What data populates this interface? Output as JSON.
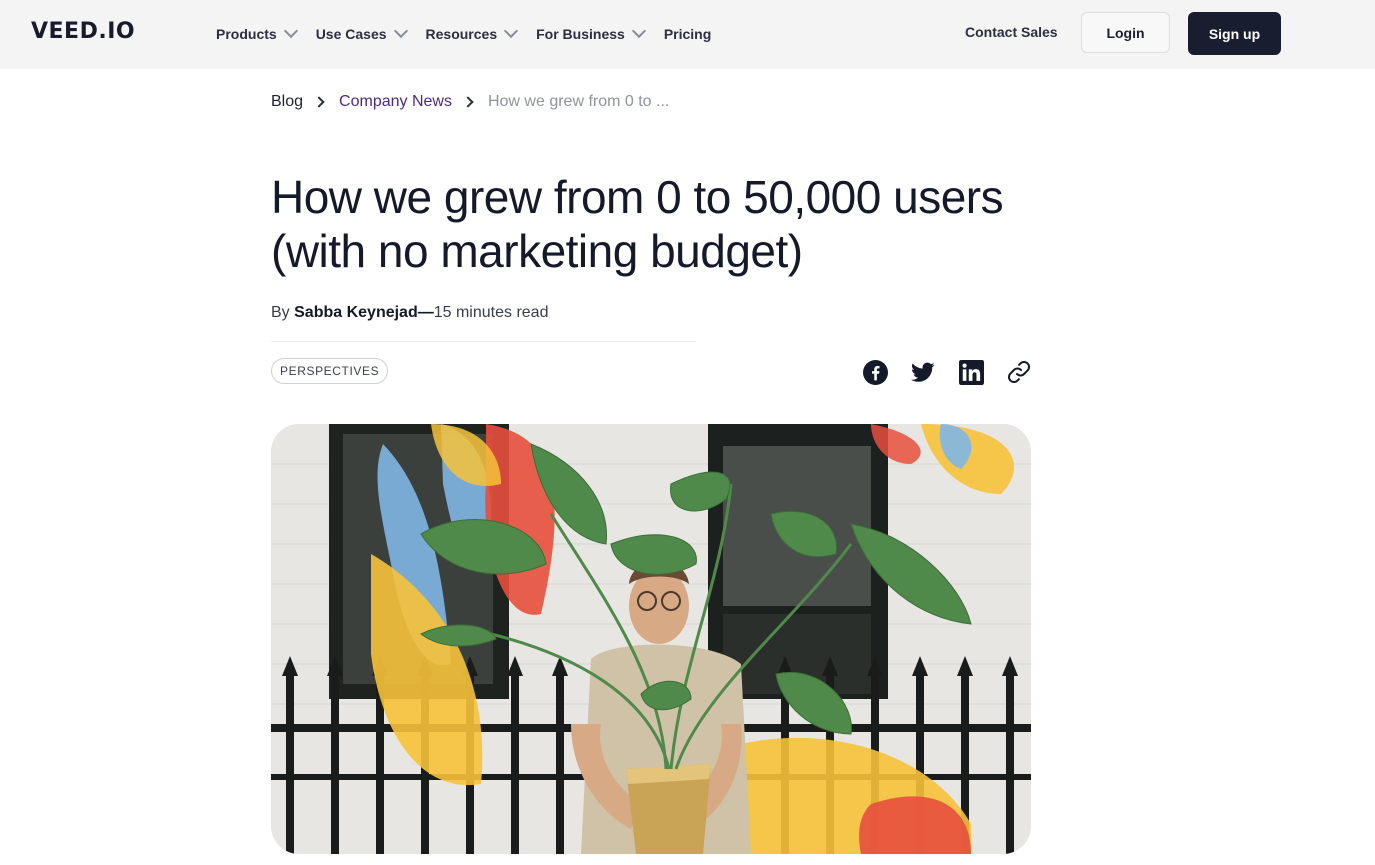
{
  "header": {
    "logo": "VEED.IO",
    "nav": [
      "Products",
      "Use Cases",
      "Resources",
      "For Business",
      "Pricing"
    ],
    "contact_sales": "Contact Sales",
    "login": "Login",
    "signup": "Sign up"
  },
  "breadcrumb": {
    "blog": "Blog",
    "category": "Company News",
    "current": "How we grew from 0 to ..."
  },
  "article": {
    "title": "How we grew from 0 to 50,000 users (with no marketing budget)",
    "by": "By",
    "author": "Sabba Keynejad",
    "dash": "—",
    "read_time": "15 minutes read",
    "tag": "PERSPECTIVES"
  },
  "share": {
    "icons": [
      "facebook-icon",
      "twitter-icon",
      "linkedin-icon",
      "link-icon"
    ]
  },
  "colors": {
    "topbar_bg": "#f4f4f5",
    "signup_bg": "#191d30",
    "breadcrumb_link": "#4f2a83",
    "text_dark": "#151a2b"
  }
}
